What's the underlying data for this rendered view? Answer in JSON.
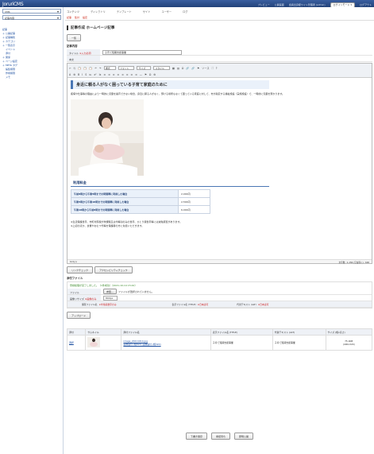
{
  "app": {
    "logo": "Joruri",
    "logo_suffix": "CMS"
  },
  "topbar": {
    "links": [
      "プレビュー",
      "公開画面",
      "会員出身経ワイト管理者 (admin)",
      "ログアウト"
    ],
    "switch_label": "ログインモード ▾"
  },
  "sidebar": {
    "site_select": "CMS",
    "content_select": "記事内容",
    "tree": [
      "記事",
      "＋ 公開記事",
      "＋ 記事種別",
      "＋ カテゴリ",
      "＋ 一覧表示",
      "　 イベント",
      "　 添付",
      "＋ 関係",
      "＋ ページ設定",
      "＋ META タグ",
      "　 編集権限",
      "　 作成権限",
      "　 メモ"
    ]
  },
  "tabs": [
    "コンテンツ",
    "ディレクトリ",
    "テンプレート",
    "サイト",
    "ユーザー",
    "ログ"
  ],
  "subtabs": [
    "記事",
    "集計",
    "設定"
  ],
  "page_title": "記事作成 ホームページ記事",
  "back_button": "一覧",
  "section_content": "記事内容",
  "title_row": {
    "label": "タイトル",
    "req": "※入力必須",
    "value": "子育て短期支援事業"
  },
  "body_label": "本文",
  "toolbar": {
    "row1": [
      "✂",
      "⎘",
      "📋",
      "📋",
      "📋",
      "↶",
      "↷",
      "書式",
      "フォント",
      "サイズ",
      "スタイル",
      "▦",
      "▥",
      "Ω",
      "🔗",
      "🔗",
      "⚑",
      "ソース",
      "⛶",
      "?"
    ],
    "row2": [
      "A",
      "⚙",
      "B",
      "I",
      "S",
      "x₂",
      "x²",
      "Ix",
      "≡",
      "≡",
      "≡",
      "≡",
      "≡",
      "≡",
      "≡",
      "≡",
      "—",
      "⚑",
      "Ω",
      "⚙"
    ]
  },
  "article": {
    "heading": "身近に頼る人がなく困っている子育て家庭のために",
    "paragraph": "疾病や仕事等の理由により一時的に児童を養育できない場合、身近に頼る人がなく、預ける場所もなくて困っている家庭に対して、市が指定する福祉施設（実施施設）で、一時的に児童を預かります。",
    "fee_heading": "利用料金",
    "fees": [
      {
        "k": "午前8時から午後5時までの時間帯に利用した場合",
        "v": "2,000円"
      },
      {
        "k": "午後5時から午後10時までの時間帯に利用した場合",
        "v": "2,500円"
      },
      {
        "k": "午後10時から午前8時までの時間帯に利用した場合",
        "v": "6,000円"
      }
    ],
    "note1": "※生活保護世帯、市町村民税が非課税又は均等割のみの世帯、ひとり親世帯等には減免措置があります。",
    "note2": "※上記のほか、食費やおむつ代等を保護者の方に負担いただきます。"
  },
  "statusbar": {
    "left": "body p",
    "right": "文字数 : 1,156 (空白除く) : 600"
  },
  "check_buttons": [
    "リンクチェック",
    "アクセシビリティチェック"
  ],
  "files_heading": "添付ファイル",
  "upload_ok": "登録処理が完了しました。（1件成功）（2021-10-14 15:42）",
  "file_row": {
    "label": "ファイル",
    "button": "参照...",
    "status": "ファイルが選択されていません。"
  },
  "size_row": {
    "label": "画像リサイズ",
    "note": "※画像のみ",
    "value": "800px"
  },
  "name_row": {
    "a": "保存ファイル名",
    "b": "表示ファイル名 (TITLE)",
    "c": "代替テキスト (ALT)",
    "hint": "※半角英数字のみ",
    "hint2": "※日本語可"
  },
  "upload_button": "アップロード",
  "list": {
    "headers": [
      "添付",
      "サムネイル",
      "添付ファイル名",
      "表示ファイル名 (TITLE)",
      "代替テキスト (ALT)",
      "サイズ (幅x高さ)"
    ],
    "row": {
      "act": "選択",
      "fname": "image_20211014.jpg",
      "links": "画像貼付 (幅820) 画像貼付 (幅320)",
      "title": "子育て短期支援事業",
      "alt": "子育て短期支援事業",
      "size": "75.4KB",
      "dim": "(400x320)"
    }
  },
  "bottom_buttons": [
    "下書き保存",
    "承認待ち",
    "即時公開"
  ]
}
